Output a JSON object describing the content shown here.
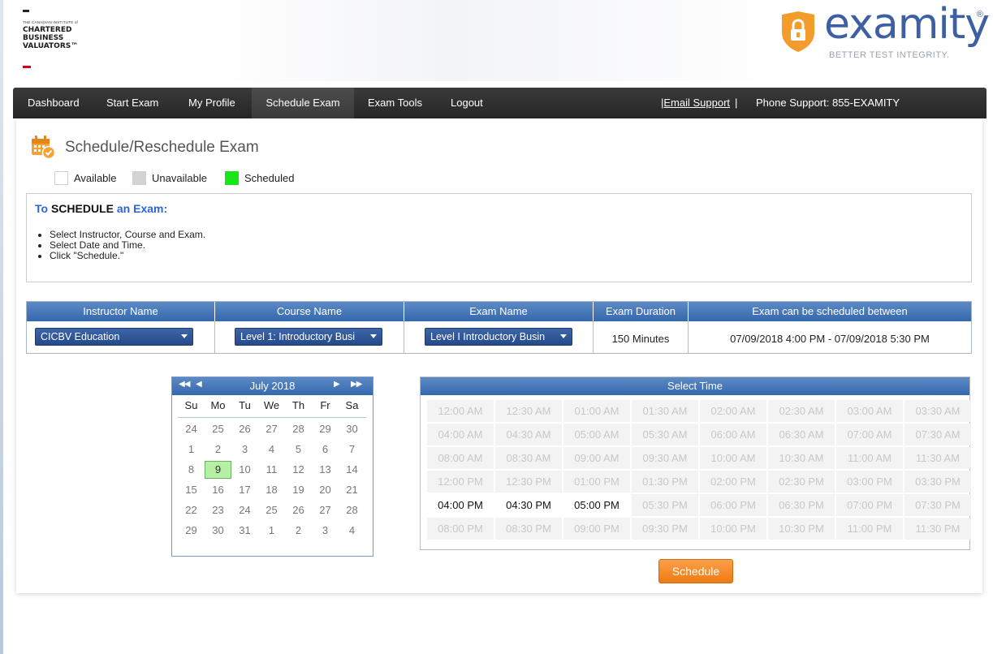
{
  "header": {
    "cbv_logo": {
      "small_text": "THE CANADIAN INSTITUTE of",
      "line1": "CHARTERED",
      "line2": "BUSINESS",
      "line3": "VALUATORS™"
    },
    "examity_logo": {
      "word": "examity",
      "registered": "®",
      "tagline": "BETTER TEST INTEGRITY."
    }
  },
  "nav": {
    "items": [
      {
        "label": "Dashboard"
      },
      {
        "label": "Start Exam"
      },
      {
        "label": "My Profile"
      },
      {
        "label": "Schedule Exam",
        "active": true
      },
      {
        "label": "Exam Tools"
      },
      {
        "label": "Logout"
      }
    ],
    "email_support": "|Email Support",
    "separator": "|",
    "phone_support": "Phone Support: 855-EXAMITY"
  },
  "page": {
    "title": "Schedule/Reschedule Exam",
    "icon": "calendar-check-icon"
  },
  "legend": [
    {
      "label": "Available",
      "color": "#ffffff"
    },
    {
      "label": "Unavailable",
      "color": "#d3d3d3"
    },
    {
      "label": "Scheduled",
      "color": "#19e619"
    }
  ],
  "instructions": {
    "title_prefix": "To ",
    "title_bold": "SCHEDULE",
    "title_suffix": " an Exam:",
    "steps": [
      "Select Instructor, Course and Exam.",
      "Select Date and Time.",
      "Click \"Schedule.\""
    ]
  },
  "exam_table": {
    "headers": [
      "Instructor Name",
      "Course Name",
      "Exam Name",
      "Exam Duration",
      "Exam can be scheduled between"
    ],
    "instructor": "CICBV Education",
    "course": "Level 1: Introductory Busi",
    "exam": "Level I Introductory Busin",
    "duration": "150 Minutes",
    "window": "07/09/2018 4:00 PM - 07/09/2018 5:30 PM"
  },
  "calendar": {
    "month_label": "July 2018",
    "prev_year": "◀◀",
    "prev_month": "◀",
    "next_month": "▶",
    "next_year": "▶▶",
    "weekdays": [
      "Su",
      "Mo",
      "Tu",
      "We",
      "Th",
      "Fr",
      "Sa"
    ],
    "weeks": [
      [
        "24",
        "25",
        "26",
        "27",
        "28",
        "29",
        "30"
      ],
      [
        "1",
        "2",
        "3",
        "4",
        "5",
        "6",
        "7"
      ],
      [
        "8",
        "9",
        "10",
        "11",
        "12",
        "13",
        "14"
      ],
      [
        "15",
        "16",
        "17",
        "18",
        "19",
        "20",
        "21"
      ],
      [
        "22",
        "23",
        "24",
        "25",
        "26",
        "27",
        "28"
      ],
      [
        "29",
        "30",
        "31",
        "1",
        "2",
        "3",
        "4"
      ]
    ],
    "selected": "9"
  },
  "time": {
    "header": "Select Time",
    "slots": [
      [
        "12:00 AM",
        "12:30 AM",
        "01:00 AM",
        "01:30 AM",
        "02:00 AM",
        "02:30 AM",
        "03:00 AM",
        "03:30 AM"
      ],
      [
        "04:00 AM",
        "04:30 AM",
        "05:00 AM",
        "05:30 AM",
        "06:00 AM",
        "06:30 AM",
        "07:00 AM",
        "07:30 AM"
      ],
      [
        "08:00 AM",
        "08:30 AM",
        "09:00 AM",
        "09:30 AM",
        "10:00 AM",
        "10:30 AM",
        "11:00 AM",
        "11:30 AM"
      ],
      [
        "12:00 PM",
        "12:30 PM",
        "01:00 PM",
        "01:30 PM",
        "02:00 PM",
        "02:30 PM",
        "03:00 PM",
        "03:30 PM"
      ],
      [
        "04:00 PM",
        "04:30 PM",
        "05:00 PM",
        "05:30 PM",
        "06:00 PM",
        "06:30 PM",
        "07:00 PM",
        "07:30 PM"
      ],
      [
        "08:00 PM",
        "08:30 PM",
        "09:00 PM",
        "09:30 PM",
        "10:00 PM",
        "10:30 PM",
        "11:00 PM",
        "11:30 PM"
      ]
    ],
    "available": [
      "04:00 PM",
      "04:30 PM",
      "05:00 PM"
    ]
  },
  "schedule_button": "Schedule",
  "colors": {
    "nav_bg": "#2e2e2e",
    "header_blue": "#3468ad",
    "accent_orange": "#f5891f",
    "examity_blue": "#3d5fa3",
    "shield_orange": "#f39c2b"
  }
}
